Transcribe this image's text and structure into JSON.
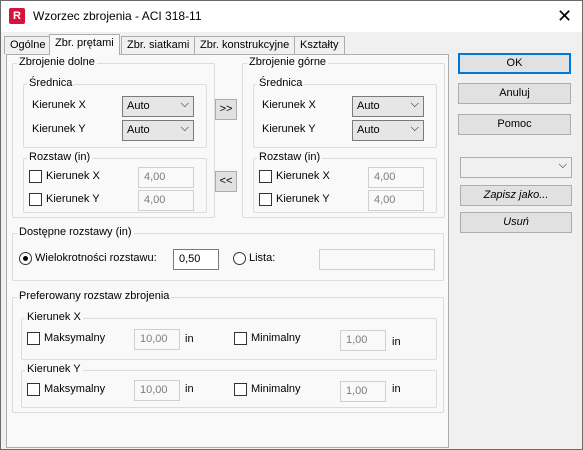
{
  "window": {
    "icon_letter": "R",
    "title": "Wzorzec zbrojenia - ACI 318-11",
    "close": "✕"
  },
  "tabs": [
    {
      "label": "Ogólne"
    },
    {
      "label": "Zbr. prętami"
    },
    {
      "label": "Zbr. siatkami"
    },
    {
      "label": "Zbr. konstrukcyjne"
    },
    {
      "label": "Kształty"
    }
  ],
  "bottom": {
    "legend": "Zbrojenie dolne",
    "diameter": {
      "legend": "Średnica",
      "dir_x": "Kierunek X",
      "dir_y": "Kierunek Y",
      "val_x": "Auto",
      "val_y": "Auto"
    },
    "spacing": {
      "legend": "Rozstaw (in)",
      "dir_x": "Kierunek X",
      "dir_y": "Kierunek Y",
      "val_x": "4,00",
      "val_y": "4,00"
    }
  },
  "top": {
    "legend": "Zbrojenie górne",
    "diameter": {
      "legend": "Średnica",
      "dir_x": "Kierunek X",
      "dir_y": "Kierunek Y",
      "val_x": "Auto",
      "val_y": "Auto"
    },
    "spacing": {
      "legend": "Rozstaw (in)",
      "dir_x": "Kierunek X",
      "dir_y": "Kierunek Y",
      "val_x": "4,00",
      "val_y": "4,00"
    }
  },
  "copy_right": ">>",
  "copy_left": "<<",
  "available": {
    "legend": "Dostępne rozstawy (in)",
    "multiple_label": "Wielokrotności rozstawu:",
    "multiple_value": "0,50",
    "list_label": "Lista:",
    "list_value": ""
  },
  "preferred": {
    "legend": "Preferowany rozstaw zbrojenia",
    "dir_x": {
      "legend": "Kierunek X",
      "max_label": "Maksymalny",
      "max_value": "10,00",
      "min_label": "Minimalny",
      "min_value": "1,00",
      "unit": "in"
    },
    "dir_y": {
      "legend": "Kierunek Y",
      "max_label": "Maksymalny",
      "max_value": "10,00",
      "min_label": "Minimalny",
      "min_value": "1,00",
      "unit": "in"
    }
  },
  "buttons": {
    "ok": "OK",
    "cancel": "Anuluj",
    "help": "Pomoc",
    "template_value": "",
    "save_as": "Zapisz jako...",
    "delete": "Usuń"
  }
}
